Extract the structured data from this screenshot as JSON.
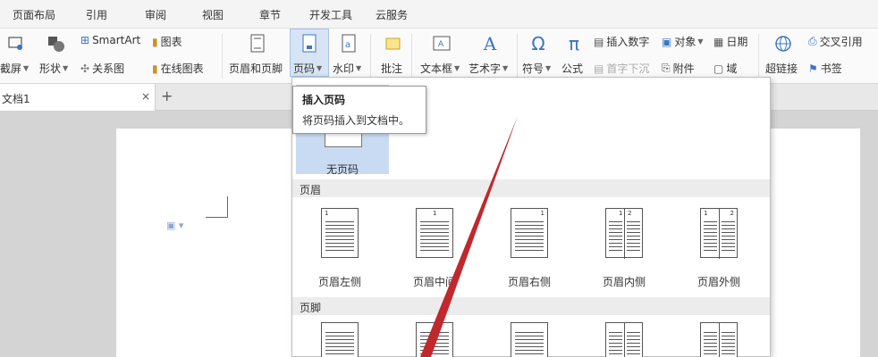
{
  "menubar": {
    "items": [
      "页面布局",
      "引用",
      "审阅",
      "视图",
      "章节",
      "开发工具",
      "云服务"
    ]
  },
  "ribbon": {
    "screenshot": "截屏",
    "shape": "形状",
    "smartart": "SmartArt",
    "chart": "图表",
    "relation": "关系图",
    "online_chart": "在线图表",
    "header_footer": "页眉和页脚",
    "page_number": "页码",
    "watermark": "水印",
    "comment": "批注",
    "textbox": "文本框",
    "wordart": "艺术字",
    "symbol": "符号",
    "formula": "公式",
    "insert_number": "插入数字",
    "drop_cap": "首字下沉",
    "object": "对象",
    "attachment": "附件",
    "date": "日期",
    "field": "域",
    "hyperlink": "超链接",
    "cross_ref": "交叉引用",
    "bookmark": "书签"
  },
  "tabs": {
    "doc_label": "文档1",
    "close": "×",
    "new": "+"
  },
  "tooltip": {
    "title": "插入页码",
    "desc": "将页码插入到文档中。"
  },
  "dropdown": {
    "no_page_number": "无页码",
    "header_section": "页眉",
    "footer_section": "页脚",
    "header_options": [
      "页眉左侧",
      "页眉中间",
      "页眉右侧",
      "页眉内侧",
      "页眉外侧"
    ]
  },
  "colors": {
    "accent": "#c9daf3",
    "annotation_arrow": "#c0282c"
  }
}
